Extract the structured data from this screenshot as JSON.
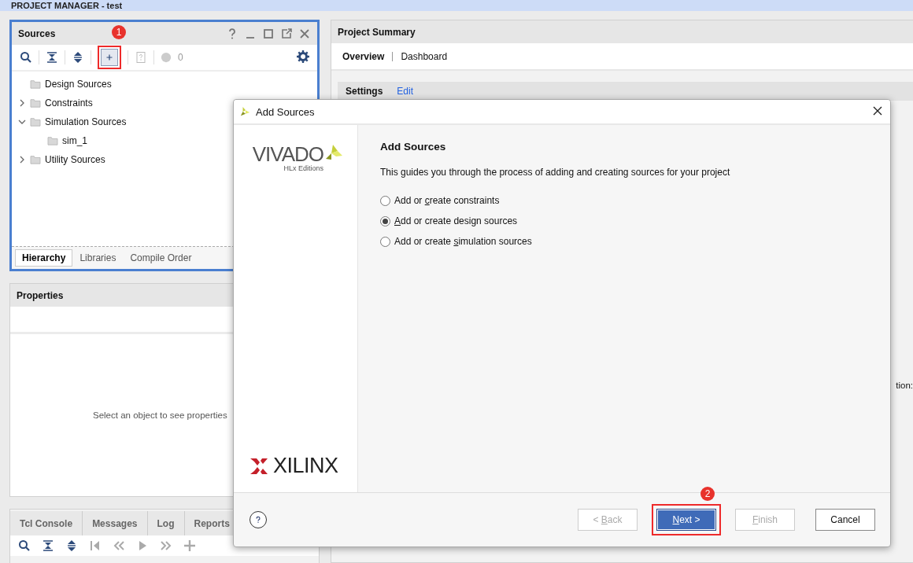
{
  "top_bar": {
    "title": "PROJECT MANAGER - test"
  },
  "sources": {
    "title": "Sources",
    "error_count": "0",
    "add_callout": "1",
    "tree": [
      {
        "label": "Design Sources",
        "expandable": false,
        "expanded": false
      },
      {
        "label": "Constraints",
        "expandable": true,
        "expanded": false
      },
      {
        "label": "Simulation Sources",
        "expandable": true,
        "expanded": true,
        "children": [
          {
            "label": "sim_1",
            "expandable": false,
            "expanded": false
          }
        ]
      },
      {
        "label": "Utility Sources",
        "expandable": true,
        "expanded": false
      }
    ],
    "tabs": [
      {
        "label": "Hierarchy",
        "selected": true
      },
      {
        "label": "Libraries",
        "selected": false
      },
      {
        "label": "Compile Order",
        "selected": false
      }
    ]
  },
  "properties": {
    "title": "Properties",
    "empty_message": "Select an object to see properties"
  },
  "console": {
    "tabs": [
      {
        "label": "Tcl Console",
        "selected": false
      },
      {
        "label": "Messages",
        "selected": false
      },
      {
        "label": "Log",
        "selected": false
      },
      {
        "label": "Reports",
        "selected": false
      }
    ]
  },
  "summary": {
    "title": "Project Summary",
    "tabs": [
      {
        "label": "Overview",
        "selected": true
      },
      {
        "label": "Dashboard",
        "selected": false
      }
    ],
    "section": {
      "title": "Settings",
      "link": "Edit"
    },
    "fragment": "tion:"
  },
  "dialog": {
    "title": "Add Sources",
    "brand": {
      "product": "VIVADO",
      "edition": "HLx Editions",
      "vendor": "XILINX"
    },
    "heading": "Add Sources",
    "description": "This guides you through the process of adding and creating sources for your project",
    "options": [
      {
        "pre": "Add or ",
        "key": "c",
        "post": "reate constraints",
        "selected": false
      },
      {
        "key": "A",
        "post": "dd or create design sources",
        "selected": true
      },
      {
        "pre": "Add or create ",
        "key": "s",
        "post": "imulation sources",
        "selected": false
      }
    ],
    "buttons": [
      {
        "pre": "< ",
        "key": "B",
        "post": "ack",
        "disabled": true,
        "primary": false
      },
      {
        "key": "N",
        "post": "ext >",
        "disabled": false,
        "primary": true,
        "callout": "2"
      },
      {
        "key": "F",
        "post": "inish",
        "disabled": true,
        "primary": false
      },
      {
        "post": "Cancel",
        "disabled": false,
        "primary": false
      }
    ]
  }
}
